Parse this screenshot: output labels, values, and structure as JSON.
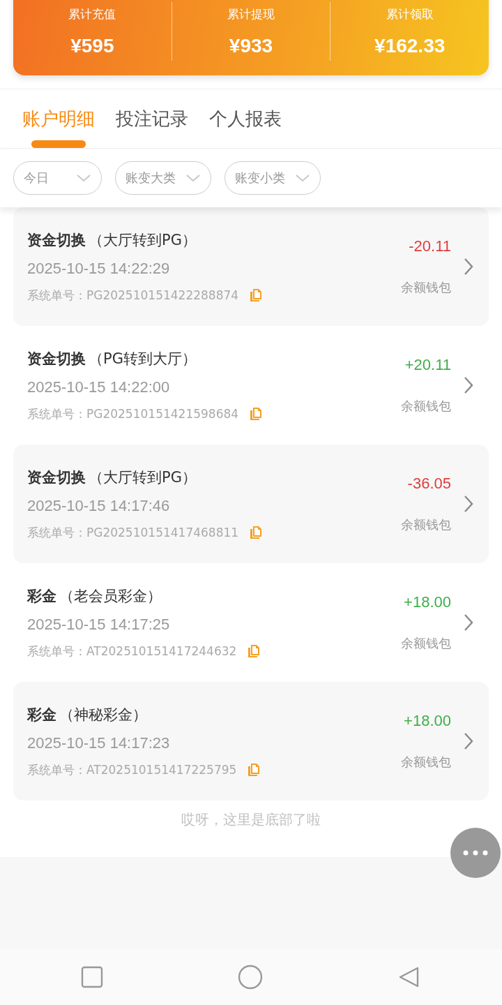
{
  "summary": [
    {
      "label": "累计充值",
      "value": "¥595"
    },
    {
      "label": "累计提现",
      "value": "¥933"
    },
    {
      "label": "累计领取",
      "value": "¥162.33"
    }
  ],
  "tabs": [
    {
      "label": "账户明细",
      "selected": true
    },
    {
      "label": "投注记录",
      "selected": false
    },
    {
      "label": "个人报表",
      "selected": false
    }
  ],
  "filters": [
    "今日",
    "账变大类",
    "账变小类"
  ],
  "records": [
    {
      "title": "资金切换",
      "detail": "（大厅转到PG）",
      "time": "2025-10-15 14:22:29",
      "order_label": "系统单号：",
      "order_no": "PG202510151422288874",
      "amount": "-20.11",
      "kind": "expense",
      "wallet": "余额钱包"
    },
    {
      "title": "资金切换",
      "detail": "（PG转到大厅）",
      "time": "2025-10-15 14:22:00",
      "order_label": "系统单号：",
      "order_no": "PG202510151421598684",
      "amount": "+20.11",
      "kind": "income",
      "wallet": "余额钱包"
    },
    {
      "title": "资金切换",
      "detail": "（大厅转到PG）",
      "time": "2025-10-15 14:17:46",
      "order_label": "系统单号：",
      "order_no": "PG202510151417468811",
      "amount": "-36.05",
      "kind": "expense",
      "wallet": "余额钱包"
    },
    {
      "title": "彩金",
      "detail": "（老会员彩金）",
      "time": "2025-10-15 14:17:25",
      "order_label": "系统单号：",
      "order_no": "AT202510151417244632",
      "amount": "+18.00",
      "kind": "income",
      "wallet": "余额钱包"
    },
    {
      "title": "彩金",
      "detail": "（神秘彩金）",
      "time": "2025-10-15 14:17:23",
      "order_label": "系统单号：",
      "order_no": "AT202510151417225795",
      "amount": "+18.00",
      "kind": "income",
      "wallet": "余额钱包"
    }
  ],
  "end_note": "哎呀，这里是底部了啦"
}
